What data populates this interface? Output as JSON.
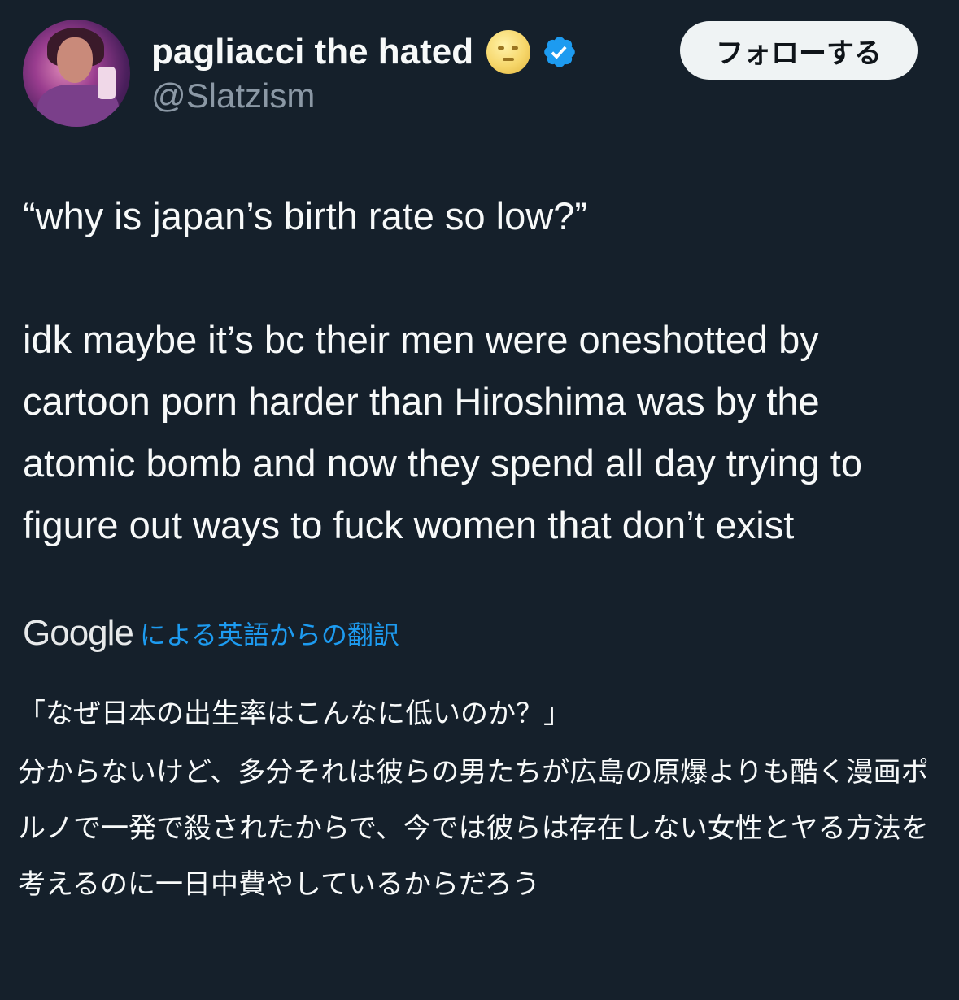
{
  "author": {
    "display_name": "pagliacci the hated",
    "emoji_icon": "full-moon-face",
    "verified_icon": "verified-badge-icon",
    "verified_color": "#1d9bf0",
    "handle": "@Slatzism"
  },
  "follow_button": {
    "label": "フォローする"
  },
  "tweet": {
    "line1": "“why is japan’s birth rate so low?”",
    "line2": "idk maybe it’s bc their men were oneshotted by cartoon porn harder than Hiroshima was by the atomic bomb and now they spend all day trying to figure out ways to fuck women that don’t exist"
  },
  "translation": {
    "provider": "Google",
    "link_label": "による英語からの翻訳",
    "line1": "「なぜ日本の出生率はこんなに低いのか？」",
    "line2": "分からないけど、多分それは彼らの男たちが広島の原爆よりも酷く漫画ポルノで一発で殺されたからで、今では彼らは存在しない女性とヤる方法を考えるのに一日中費やしているからだろう"
  },
  "colors": {
    "background": "#15202b",
    "text": "#f7f9f9",
    "secondary_text": "#8b98a5",
    "link": "#1d9bf0",
    "button_bg": "#eff3f4"
  }
}
